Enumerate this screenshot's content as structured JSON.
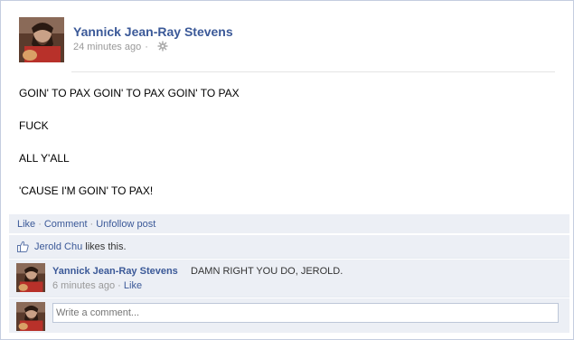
{
  "post": {
    "author": "Yannick Jean-Ray Stevens",
    "timestamp": "24 minutes ago",
    "meta_separator": "·",
    "privacy_icon": "gear-icon",
    "lines": [
      "GOIN' TO PAX GOIN' TO PAX GOIN' TO PAX",
      "FUCK",
      "ALL Y'ALL",
      "'CAUSE I'M GOIN' TO PAX!"
    ]
  },
  "actions": {
    "like": "Like",
    "comment": "Comment",
    "unfollow": "Unfollow post",
    "separator": "·"
  },
  "likes": {
    "icon": "thumbs-up-icon",
    "liker": "Jerold Chu",
    "suffix": " likes this."
  },
  "comment": {
    "author": "Yannick Jean-Ray Stevens",
    "text": "DAMN RIGHT YOU DO, JEROLD.",
    "timestamp": "6 minutes ago",
    "separator": "·",
    "like": "Like"
  },
  "reply": {
    "placeholder": "Write a comment..."
  },
  "colors": {
    "link": "#3b5998",
    "panel": "#eceff5",
    "muted": "#999999"
  }
}
